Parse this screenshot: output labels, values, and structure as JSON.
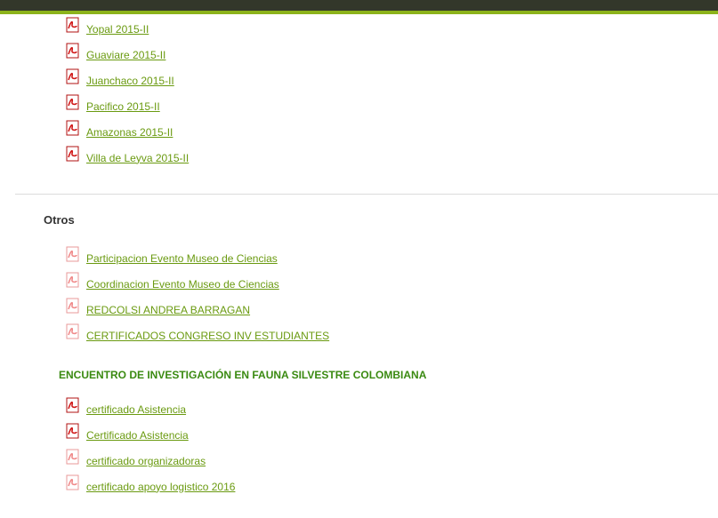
{
  "icons": {
    "pdf": "pdf-file-icon"
  },
  "colors": {
    "link": "#6a9a10",
    "heading_green": "#3a8a11",
    "top_bar": "#33372a",
    "accent": "#8cb31b"
  },
  "group_top": {
    "items": [
      {
        "label": "Yopal 2015-II"
      },
      {
        "label": "Guaviare 2015-II"
      },
      {
        "label": "Juanchaco 2015-II"
      },
      {
        "label": "Pacifico 2015-II"
      },
      {
        "label": "Amazonas 2015-II"
      },
      {
        "label": "Villa de Leyva 2015-II"
      }
    ]
  },
  "otros": {
    "heading": "Otros",
    "items": [
      {
        "label": "Participacion Evento Museo de Ciencias"
      },
      {
        "label": "Coordinacion Evento Museo de Ciencias"
      },
      {
        "label": "REDCOLSI ANDREA BARRAGAN"
      },
      {
        "label": "CERTIFICADOS CONGRESO INV ESTUDIANTES"
      }
    ]
  },
  "encuentro": {
    "heading": "ENCUENTRO DE INVESTIGACIÓN EN FAUNA SILVESTRE COLOMBIANA",
    "items": [
      {
        "label": "certificado Asistencia"
      },
      {
        "label": "Certificado Asistencia"
      },
      {
        "label": "certificado organizadoras"
      },
      {
        "label": "certificado apoyo logistico 2016"
      }
    ]
  }
}
